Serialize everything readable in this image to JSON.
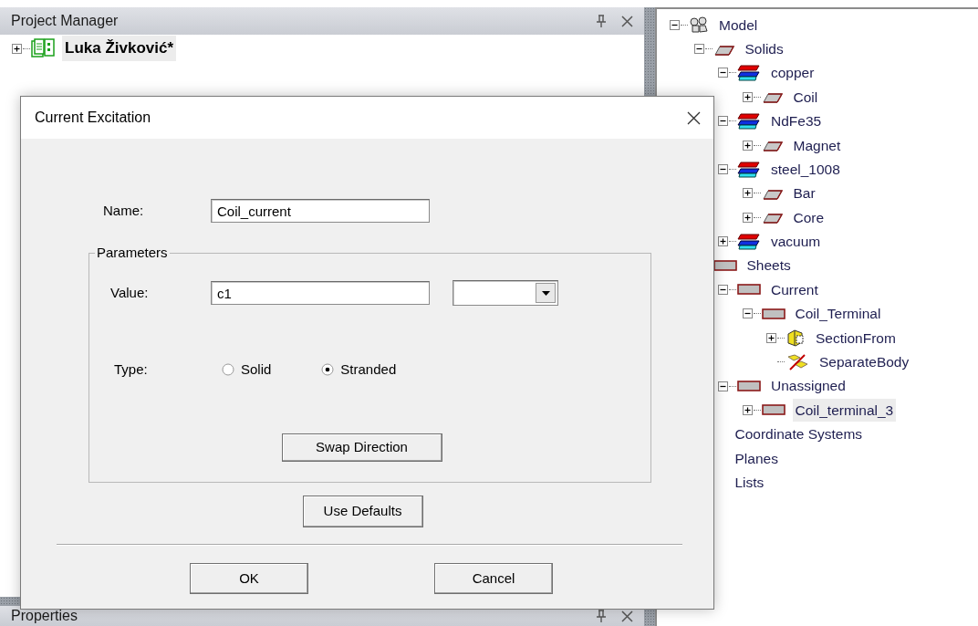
{
  "project_manager": {
    "title": "Project Manager",
    "tree": [
      {
        "label": "Luka Živković*",
        "kind": "project",
        "expanded": false,
        "selected": true
      }
    ]
  },
  "properties": {
    "title": "Properties"
  },
  "model_tree": [
    {
      "label": "Model",
      "kind": "model",
      "expanded": true,
      "selected": false,
      "children": [
        {
          "label": "Solids",
          "kind": "solid",
          "expanded": true,
          "selected": false,
          "children": [
            {
              "label": "copper",
              "kind": "material",
              "expanded": true,
              "selected": false,
              "children": [
                {
                  "label": "Coil",
                  "kind": "solid",
                  "expanded": false,
                  "selected": false
                }
              ]
            },
            {
              "label": "NdFe35",
              "kind": "material",
              "expanded": true,
              "selected": false,
              "children": [
                {
                  "label": "Magnet",
                  "kind": "solid",
                  "expanded": false,
                  "selected": false
                }
              ]
            },
            {
              "label": "steel_1008",
              "kind": "material",
              "expanded": true,
              "selected": false,
              "children": [
                {
                  "label": "Bar",
                  "kind": "solid",
                  "expanded": false,
                  "selected": false
                },
                {
                  "label": "Core",
                  "kind": "solid",
                  "expanded": false,
                  "selected": false
                }
              ]
            },
            {
              "label": "vacuum",
              "kind": "material",
              "expanded": false,
              "selected": false
            }
          ]
        },
        {
          "label": "Sheets",
          "kind": "sheet",
          "selected": false,
          "children": [
            {
              "label": "Current",
              "kind": "sheet",
              "expanded": true,
              "selected": false,
              "children": [
                {
                  "label": "Coil_Terminal",
                  "kind": "sheet",
                  "expanded": true,
                  "selected": false,
                  "children": [
                    {
                      "label": "SectionFrom",
                      "kind": "section",
                      "expanded": false,
                      "selected": false
                    },
                    {
                      "label": "SeparateBody",
                      "kind": "separate",
                      "selected": false
                    }
                  ]
                }
              ]
            },
            {
              "label": "Unassigned",
              "kind": "sheet",
              "expanded": true,
              "selected": false,
              "children": [
                {
                  "label": "Coil_terminal_3",
                  "kind": "sheet",
                  "expanded": false,
                  "selected": true
                }
              ]
            }
          ]
        },
        {
          "label": "Coordinate Systems",
          "kind": "plain",
          "selected": false
        },
        {
          "label": "Planes",
          "kind": "plain",
          "selected": false
        },
        {
          "label": "Lists",
          "kind": "plain",
          "selected": false
        }
      ]
    }
  ],
  "dialog": {
    "title": "Current Excitation",
    "name_label": "Name:",
    "name_value": "Coil_current",
    "group_title": "Parameters",
    "value_label": "Value:",
    "value": "c1",
    "type_label": "Type:",
    "type_options": [
      {
        "label": "Solid",
        "selected": false
      },
      {
        "label": "Stranded",
        "selected": true
      }
    ],
    "swap_button": "Swap Direction",
    "defaults_button": "Use Defaults",
    "buttons": [
      "OK",
      "Cancel"
    ]
  }
}
